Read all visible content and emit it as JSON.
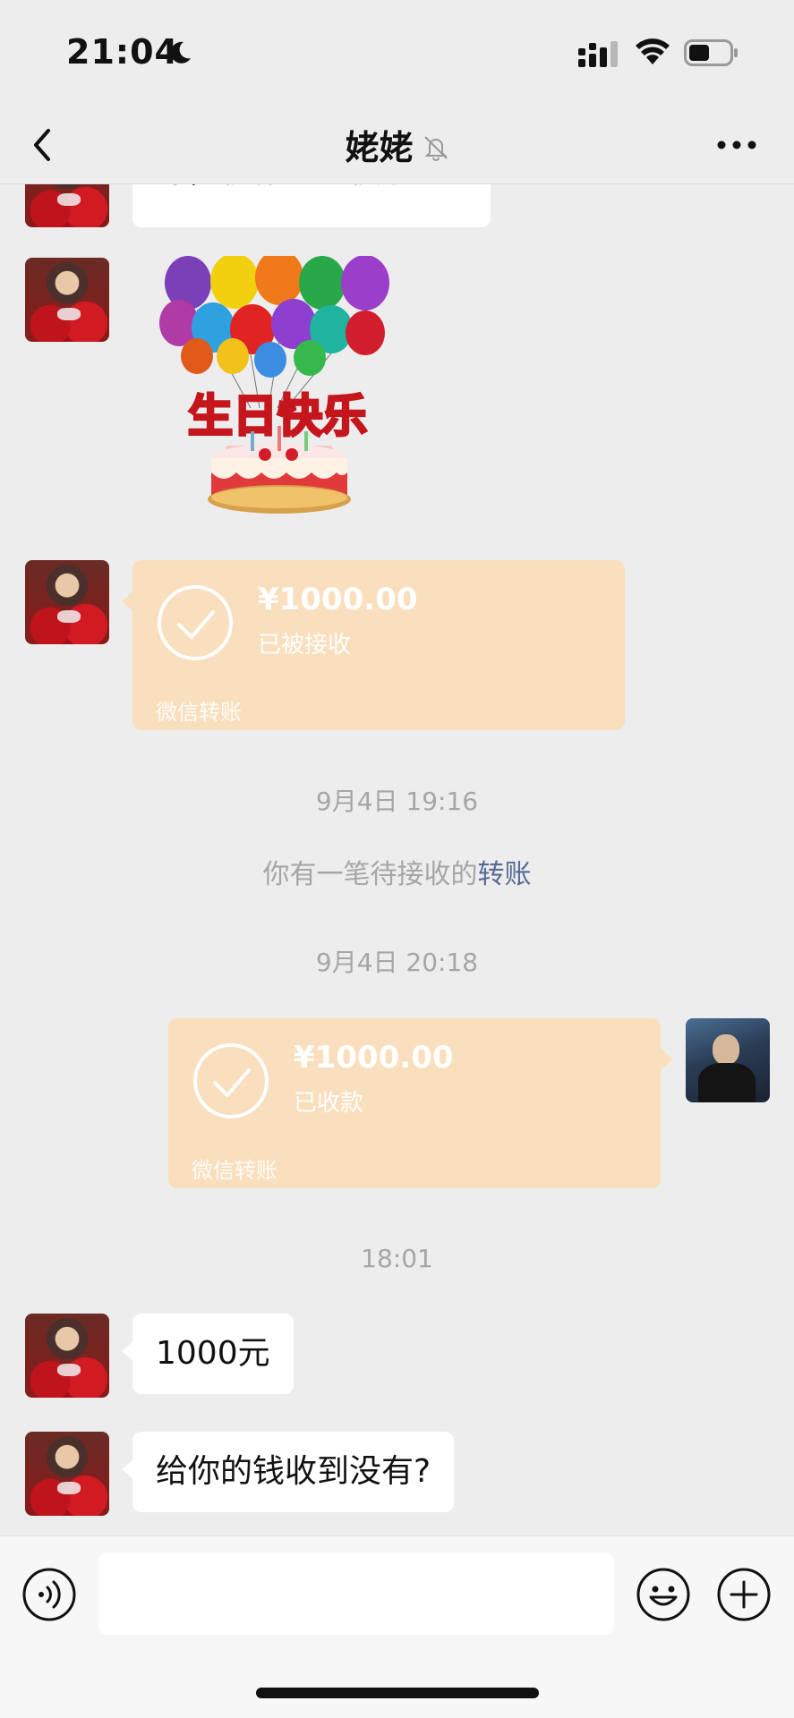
{
  "status_bar": {
    "time": "21:04",
    "icons": [
      "moon-icon",
      "signal-icon",
      "wifi-icon",
      "battery-icon"
    ]
  },
  "nav": {
    "title": "姥姥",
    "icons": [
      "back-icon",
      "mute-bell-icon",
      "more-icon"
    ]
  },
  "messages": {
    "partial_text": "嫁，祝你生日快乐。",
    "sticker_text": "生日快乐",
    "transfer_received": {
      "amount": "¥1000.00",
      "status": "已被接收",
      "footer": "微信转账"
    },
    "ts1": "9月4日 19:16",
    "pending_note_prefix": "你有一笔待接收的",
    "pending_note_link": "转账",
    "ts2": "9月4日 20:18",
    "transfer_sent": {
      "amount": "¥1000.00",
      "status": "已收款",
      "footer": "微信转账"
    },
    "ts3": "18:01",
    "msg1": "1000元",
    "msg2": "给你的钱收到没有?"
  },
  "input_bar": {
    "value": "",
    "icons": [
      "voice-icon",
      "emoji-icon",
      "plus-icon"
    ]
  },
  "colors": {
    "background": "#ededed",
    "transfer_card": "#f9dfbd",
    "link": "#576b95",
    "timestamp": "#a6a6a6"
  }
}
